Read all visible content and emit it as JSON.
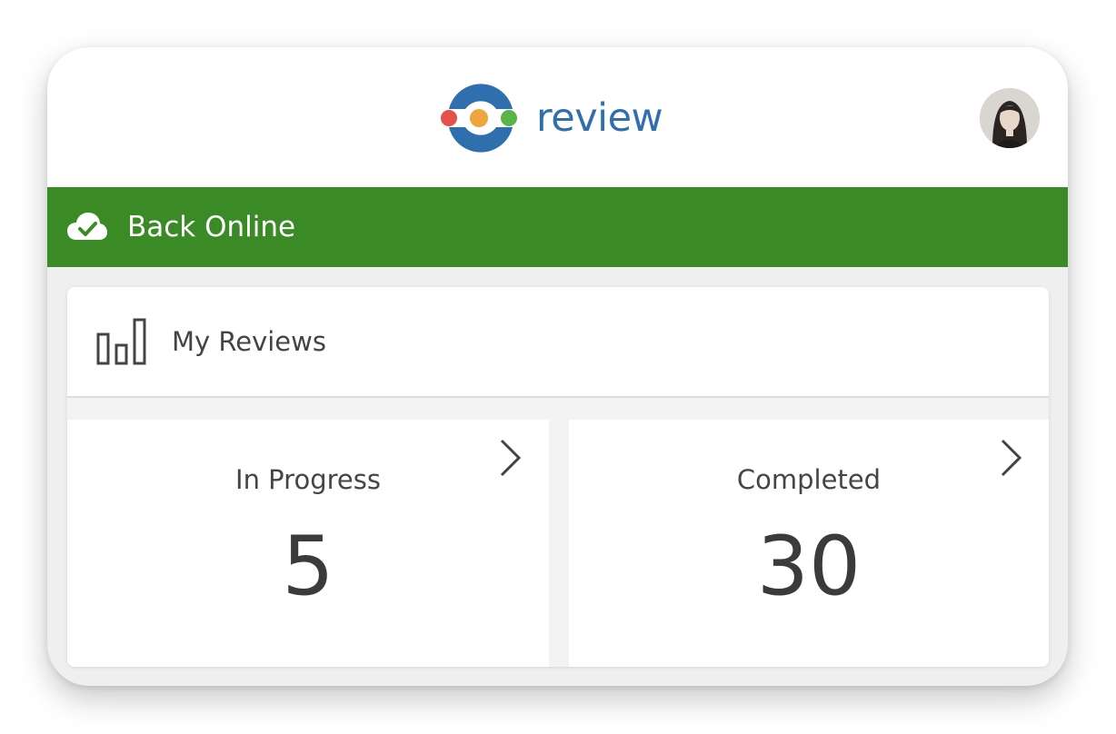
{
  "app": {
    "brand_name": "review",
    "logo_colors": {
      "ring": "#2f6fae",
      "dot_left": "#e3524a",
      "dot_middle": "#f0a53c",
      "dot_right": "#5ab547"
    },
    "profile_avatar": "user-avatar"
  },
  "banner": {
    "text": "Back Online",
    "icon": "cloud-check-icon",
    "color": "#3a8a26"
  },
  "my_reviews": {
    "title": "My Reviews",
    "icon": "bar-chart-icon",
    "tiles": [
      {
        "label": "In Progress",
        "value": "5",
        "icon": "chevron-right-icon"
      },
      {
        "label": "Completed",
        "value": "30",
        "icon": "chevron-right-icon"
      }
    ]
  }
}
